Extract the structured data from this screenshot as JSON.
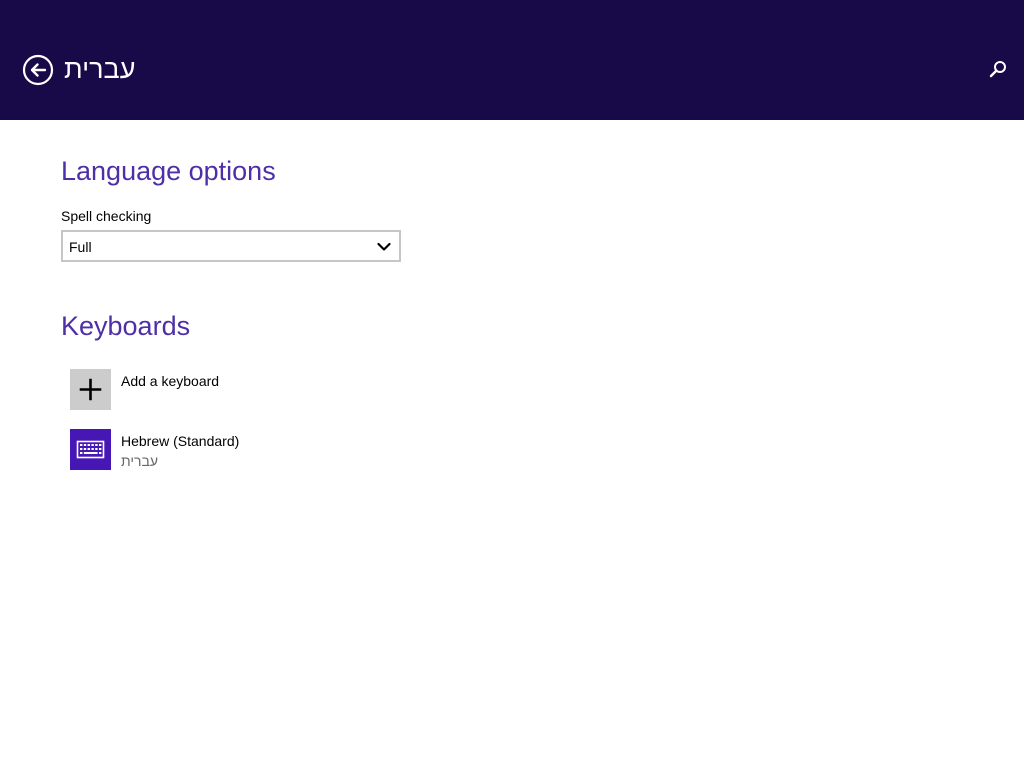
{
  "header": {
    "title": "עברית",
    "back_icon": "back-arrow-circle-icon",
    "search_icon": "search-icon"
  },
  "language_options": {
    "title": "Language options",
    "spell_checking": {
      "label": "Spell checking",
      "selected": "Full"
    }
  },
  "keyboards": {
    "title": "Keyboards",
    "add": {
      "label": "Add a keyboard",
      "icon": "plus-icon"
    },
    "items": [
      {
        "name": "Hebrew (Standard)",
        "language": "עברית",
        "icon": "keyboard-icon"
      }
    ]
  },
  "colors": {
    "header_bg": "#180a48",
    "accent": "#4e2fa8",
    "keyboard_tile": "#4617b4",
    "add_tile": "#cccccc"
  }
}
